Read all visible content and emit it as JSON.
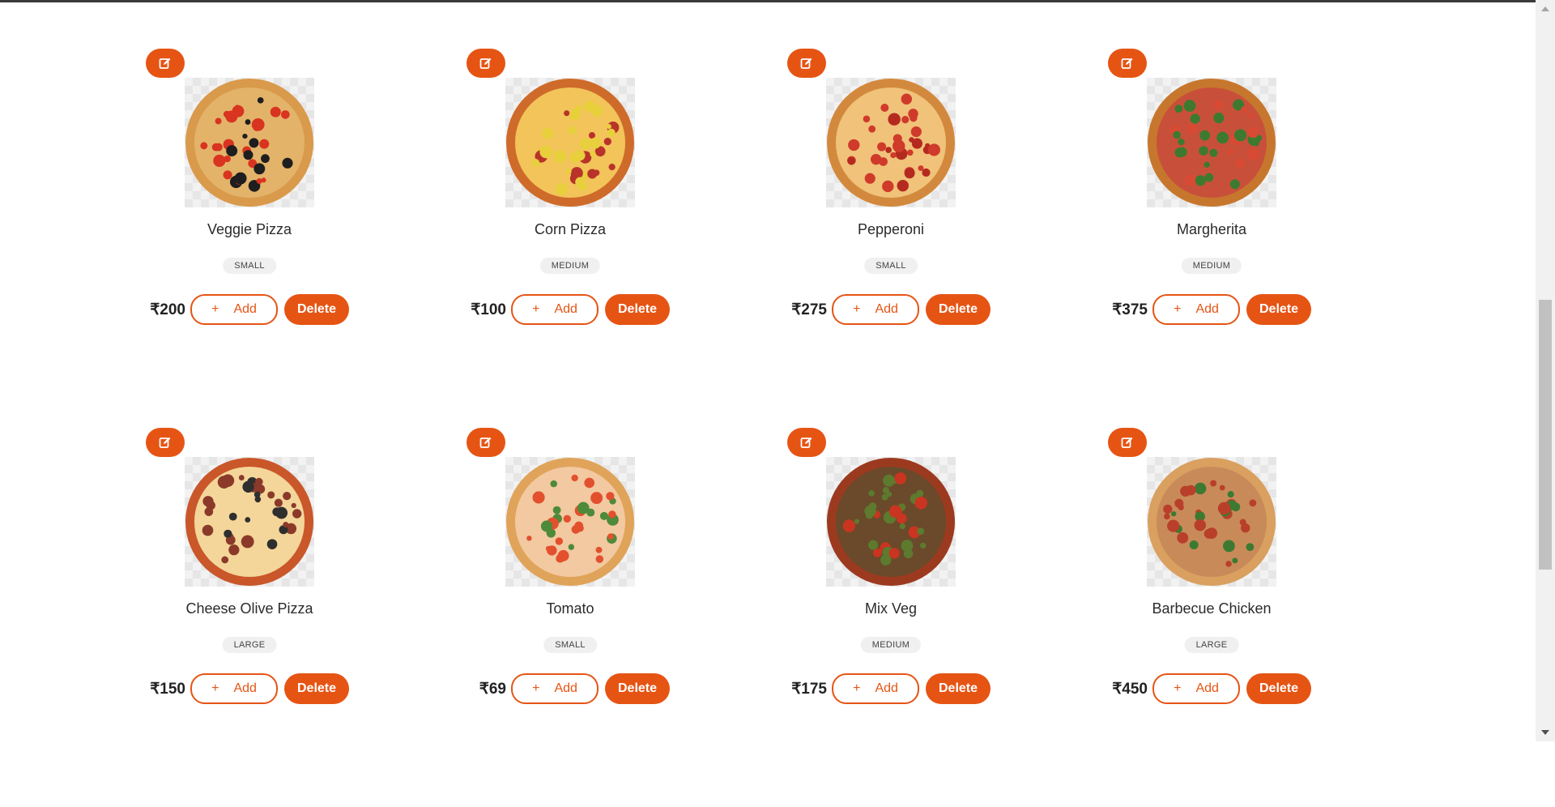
{
  "colors": {
    "accent": "#e65414",
    "badge_bg": "#f0f0f0",
    "text": "#2b2b2b"
  },
  "icons": {
    "edit": "edit-square-icon",
    "add": "plus-icon"
  },
  "pizzas": [
    {
      "name": "Veggie Pizza",
      "size": "SMALL",
      "price": "₹200",
      "add_label": "Add",
      "add_symbol": "+",
      "delete_label": "Delete",
      "crust": "#d99a4c",
      "sauce": "#e3b36a",
      "topping1": "#d8341f",
      "topping2": "#1e1e1e"
    },
    {
      "name": "Corn Pizza",
      "size": "MEDIUM",
      "price": "₹100",
      "add_label": "Add",
      "add_symbol": "+",
      "delete_label": "Delete",
      "crust": "#cf6b2a",
      "sauce": "#f2c45a",
      "topping1": "#e7d03c",
      "topping2": "#b9332a"
    },
    {
      "name": "Pepperoni",
      "size": "SMALL",
      "price": "₹275",
      "add_label": "Add",
      "add_symbol": "+",
      "delete_label": "Delete",
      "crust": "#d3893d",
      "sauce": "#f0c27a",
      "topping1": "#d03a2a",
      "topping2": "#b52a1f"
    },
    {
      "name": "Margherita",
      "size": "MEDIUM",
      "price": "₹375",
      "add_label": "Add",
      "add_symbol": "+",
      "delete_label": "Delete",
      "crust": "#c7772d",
      "sauce": "#c8503a",
      "topping1": "#3d7a2f",
      "topping2": "#d84a33"
    },
    {
      "name": "Cheese Olive Pizza",
      "size": "LARGE",
      "price": "₹150",
      "add_label": "Add",
      "add_symbol": "+",
      "delete_label": "Delete",
      "crust": "#c9572a",
      "sauce": "#f4d69a",
      "topping1": "#8b3a2a",
      "topping2": "#2f2f2f"
    },
    {
      "name": "Tomato",
      "size": "SMALL",
      "price": "₹69",
      "add_label": "Add",
      "add_symbol": "+",
      "delete_label": "Delete",
      "crust": "#e0a35a",
      "sauce": "#f2c9a0",
      "topping1": "#e2502e",
      "topping2": "#4d8a3a"
    },
    {
      "name": "Mix Veg",
      "size": "MEDIUM",
      "price": "₹175",
      "add_label": "Add",
      "add_symbol": "+",
      "delete_label": "Delete",
      "crust": "#9c3a20",
      "sauce": "#6a4a2a",
      "topping1": "#5d7a2e",
      "topping2": "#c93520"
    },
    {
      "name": "Barbecue Chicken",
      "size": "LARGE",
      "price": "₹450",
      "add_label": "Add",
      "add_symbol": "+",
      "delete_label": "Delete",
      "crust": "#d9a060",
      "sauce": "#c98a5a",
      "topping1": "#b8402a",
      "topping2": "#3c7a32"
    }
  ]
}
